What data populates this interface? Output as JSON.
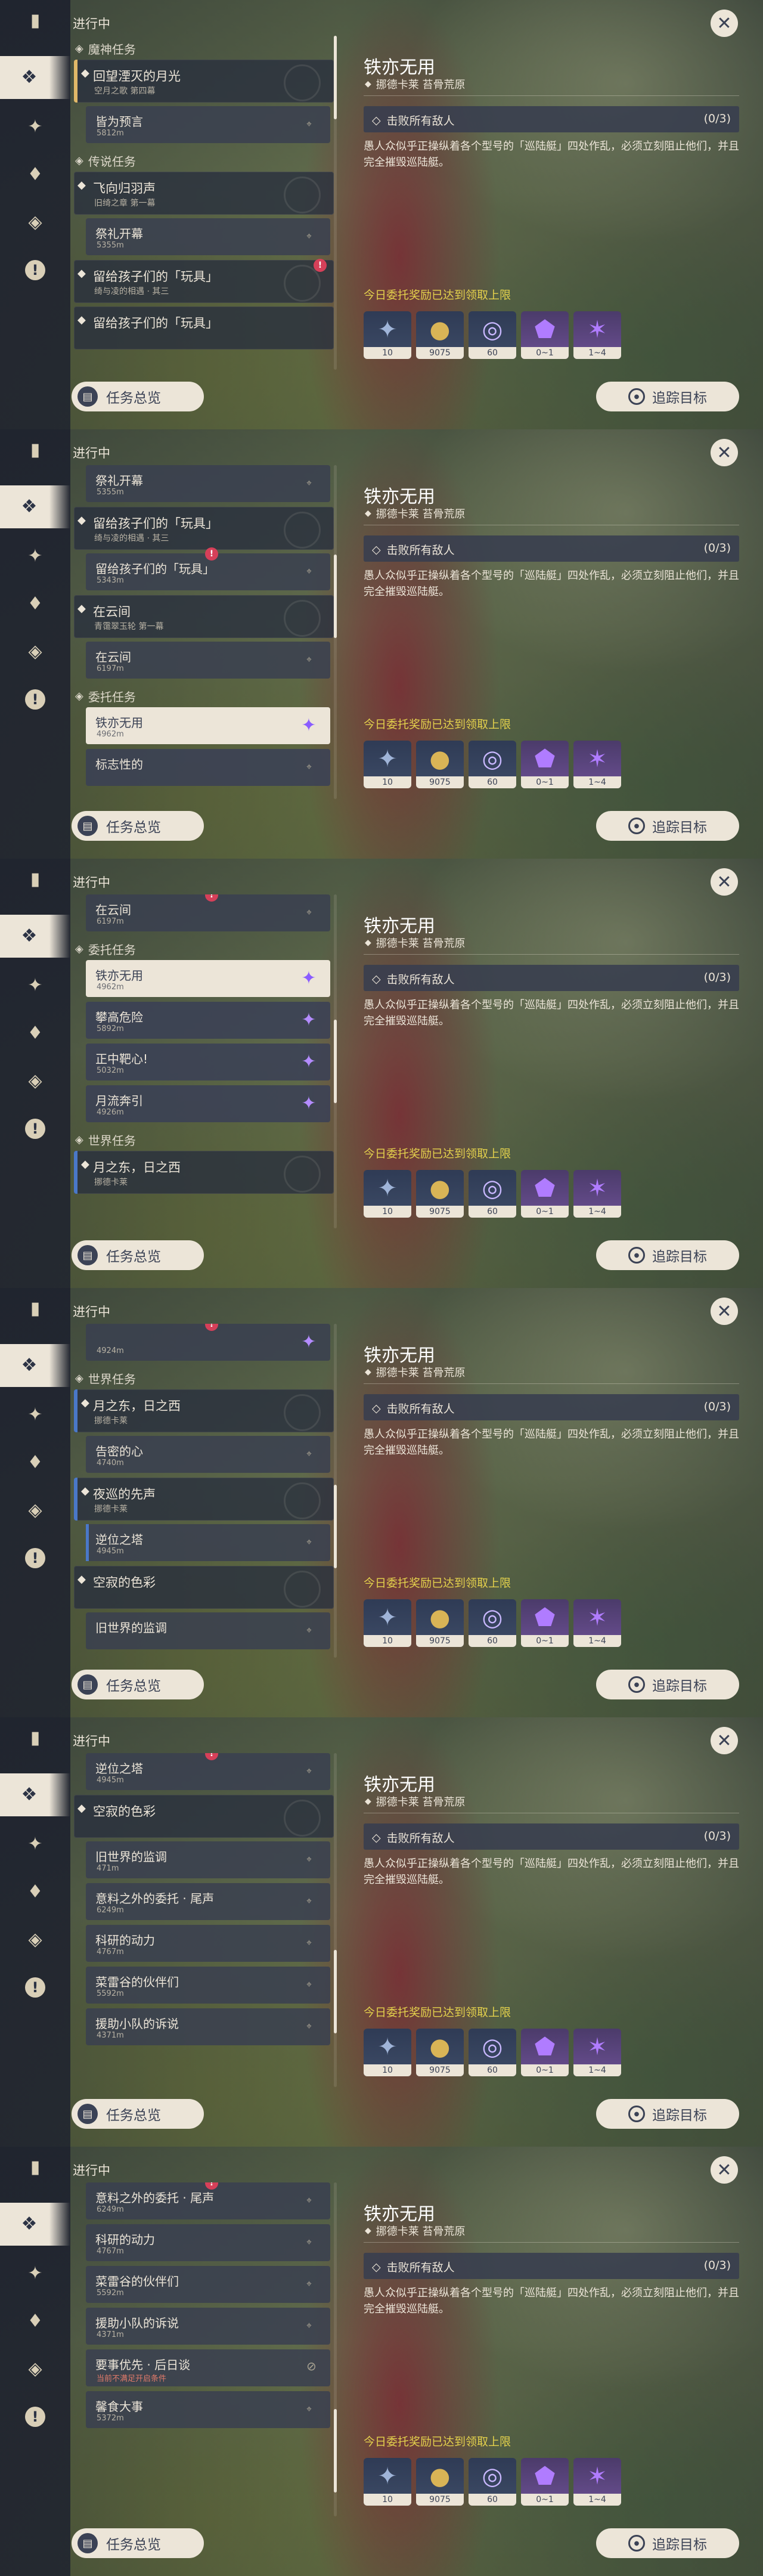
{
  "rail_icons": [
    "quest-icon",
    "commission-icon",
    "archon-icon",
    "story-icon",
    "world-icon",
    "event-icon"
  ],
  "status_label": "进行中",
  "detail": {
    "title": "铁亦无用",
    "location": "挪德卡莱 苔骨荒原",
    "objective": "击败所有敌人",
    "objective_count": "(0/3)",
    "description": "愚人众似乎正操纵着各个型号的「巡陆艇」四处作乱，必须立刻阻止他们，并且完全摧毁巡陆艇。",
    "daily_limit": "今日委托奖励已达到领取上限",
    "rewards": [
      {
        "icon": "adventure-exp-icon",
        "count": "10",
        "purple": false
      },
      {
        "icon": "mora-icon",
        "count": "9075",
        "purple": false
      },
      {
        "icon": "friendship-exp-icon",
        "count": "60",
        "purple": false
      },
      {
        "icon": "crystal-chunk-icon",
        "count": "0~1",
        "purple": true
      },
      {
        "icon": "crystal-cluster-icon",
        "count": "1~4",
        "purple": true
      }
    ]
  },
  "buttons": {
    "overview": "任务总览",
    "track": "追踪目标"
  },
  "panels": [
    {
      "rows": [
        {
          "kind": "sect",
          "label": "魔神任务"
        },
        {
          "kind": "main",
          "title": "回望湮灭的月光",
          "sub": "空月之歌 第四幕",
          "bar": "#e0b868",
          "emblem": true
        },
        {
          "kind": "sub",
          "title": "皆为预言",
          "dist": "5812m"
        },
        {
          "kind": "sect",
          "label": "传说任务"
        },
        {
          "kind": "main",
          "title": "飞向归羽声",
          "sub": "旧绮之章 第一幕",
          "bar": "",
          "emblem": true
        },
        {
          "kind": "sub",
          "title": "祭礼开幕",
          "dist": "5355m"
        },
        {
          "kind": "main",
          "title": "留给孩子们的「玩具」",
          "sub": "绮与凌的相遇 · 其三",
          "bar": "",
          "emblem": true,
          "badge": true
        },
        {
          "kind": "main",
          "title": "留给孩子们的「玩具」",
          "sub": "",
          "bar": "",
          "emblem": false
        }
      ]
    },
    {
      "rows": [
        {
          "kind": "sub",
          "title": "祭礼开幕",
          "dist": "5355m"
        },
        {
          "kind": "main",
          "title": "留给孩子们的「玩具」",
          "sub": "绮与凌的相遇 · 其三",
          "bar": "",
          "emblem": true
        },
        {
          "kind": "sub",
          "title": "留给孩子们的「玩具」",
          "dist": "5343m",
          "badge": true
        },
        {
          "kind": "main",
          "title": "在云间",
          "sub": "青霭翠玉轮 第一幕",
          "bar": "",
          "emblem": true
        },
        {
          "kind": "sub",
          "title": "在云间",
          "dist": "6197m"
        },
        {
          "kind": "sect",
          "label": "委托任务"
        },
        {
          "kind": "sub",
          "title": "铁亦无用",
          "dist": "4962m",
          "selected": true,
          "crystal": true
        },
        {
          "kind": "sub",
          "title": "标志性的",
          "dist": "",
          "cmd": true
        }
      ]
    },
    {
      "rows": [
        {
          "kind": "sub",
          "title": "在云间",
          "dist": "6197m",
          "badge": true
        },
        {
          "kind": "sect",
          "label": "委托任务"
        },
        {
          "kind": "sub",
          "title": "铁亦无用",
          "dist": "4962m",
          "selected": true,
          "crystal": true
        },
        {
          "kind": "sub",
          "title": "攀高危险",
          "dist": "5892m",
          "cmd": true,
          "crystal": true
        },
        {
          "kind": "sub",
          "title": "正中靶心!",
          "dist": "5032m",
          "cmd": true,
          "crystal": true
        },
        {
          "kind": "sub",
          "title": "月流奔引",
          "dist": "4926m",
          "cmd": true,
          "crystal": true
        },
        {
          "kind": "sect",
          "label": "世界任务"
        },
        {
          "kind": "main",
          "title": "月之东，日之西",
          "sub": "挪德卡莱",
          "bar": "#4a78c8",
          "emblem": true
        }
      ]
    },
    {
      "rows": [
        {
          "kind": "sub",
          "title": "",
          "dist": "4924m",
          "crystal": true,
          "badge": true
        },
        {
          "kind": "sect",
          "label": "世界任务"
        },
        {
          "kind": "main",
          "title": "月之东，日之西",
          "sub": "挪德卡莱",
          "bar": "#4a78c8",
          "emblem": true
        },
        {
          "kind": "sub",
          "title": "告密的心",
          "dist": "4740m"
        },
        {
          "kind": "main",
          "title": "夜巡的先声",
          "sub": "挪德卡莱",
          "bar": "#4a78c8",
          "emblem": true
        },
        {
          "kind": "sub",
          "title": "逆位之塔",
          "dist": "4945m",
          "bar": "#4a78c8"
        },
        {
          "kind": "main",
          "title": "空寂的色彩",
          "sub": "",
          "bar": "",
          "emblem": true
        },
        {
          "kind": "sub",
          "title": "旧世界的监调",
          "dist": ""
        }
      ]
    },
    {
      "rows": [
        {
          "kind": "sub",
          "title": "逆位之塔",
          "dist": "4945m",
          "badge": true
        },
        {
          "kind": "main",
          "title": "空寂的色彩",
          "sub": "",
          "bar": "",
          "emblem": true
        },
        {
          "kind": "sub",
          "title": "旧世界的监调",
          "dist": "471m"
        },
        {
          "kind": "sub",
          "title": "意料之外的委托 · 尾声",
          "dist": "6249m"
        },
        {
          "kind": "sub",
          "title": "科研的动力",
          "dist": "4767m"
        },
        {
          "kind": "sub",
          "title": "菜雷谷的伙伴们",
          "dist": "5592m"
        },
        {
          "kind": "sub",
          "title": "援助小队的诉说",
          "dist": "4371m"
        }
      ]
    },
    {
      "rows": [
        {
          "kind": "sub",
          "title": "意料之外的委托 · 尾声",
          "dist": "6249m",
          "badge": true
        },
        {
          "kind": "sub",
          "title": "科研的动力",
          "dist": "4767m"
        },
        {
          "kind": "sub",
          "title": "菜雷谷的伙伴们",
          "dist": "5592m"
        },
        {
          "kind": "sub",
          "title": "援助小队的诉说",
          "dist": "4371m"
        },
        {
          "kind": "sub",
          "title": "要事优先 · 后日谈",
          "dist": "当前不满足开启条件",
          "blocked": true
        },
        {
          "kind": "sub",
          "title": "馨食大事",
          "dist": "5372m"
        }
      ]
    }
  ]
}
